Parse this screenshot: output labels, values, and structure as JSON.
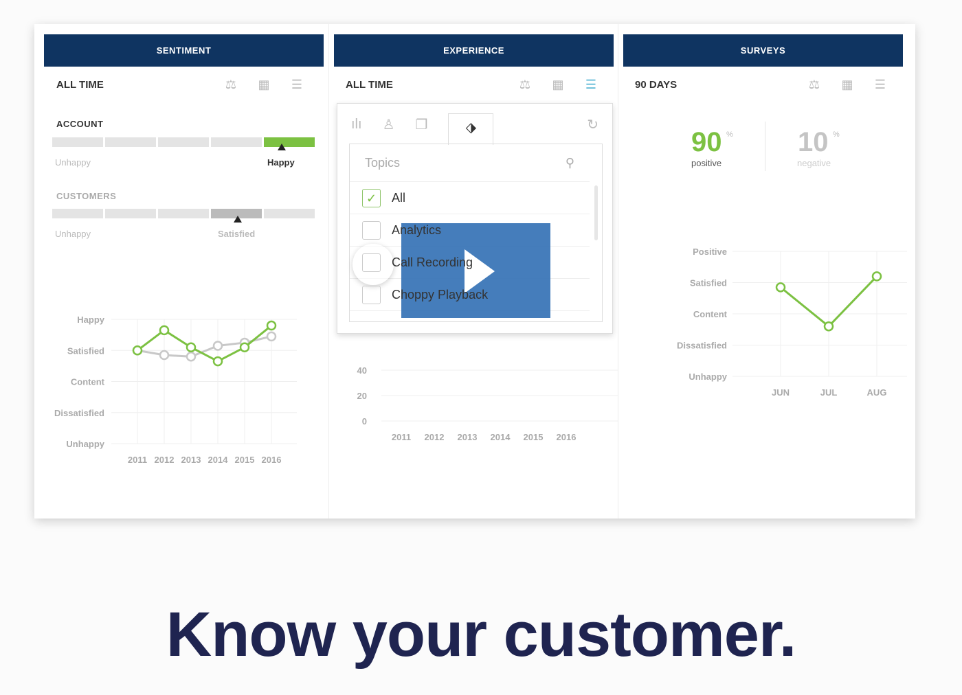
{
  "columns": [
    {
      "title": "SENTIMENT",
      "range": "ALL TIME"
    },
    {
      "title": "EXPERIENCE",
      "range": "ALL TIME"
    },
    {
      "title": "SURVEYS",
      "range": "90 DAYS"
    }
  ],
  "toolbar_icons": [
    "compare-icon",
    "calendar-icon",
    "filter-toggle-icon"
  ],
  "sentiment": {
    "account": {
      "label": "ACCOUNT",
      "left": "Unhappy",
      "value": "Happy",
      "level": 5,
      "of": 5,
      "color": "#7cc142"
    },
    "customers": {
      "label": "CUSTOMERS",
      "left": "Unhappy",
      "value": "Satisfied",
      "level": 4,
      "of": 5
    }
  },
  "popup": {
    "tabs": [
      "chart-icon",
      "user-icon",
      "document-icon",
      "tag-icon"
    ],
    "reset": "refresh-icon",
    "search_placeholder": "Topics",
    "items": [
      {
        "label": "All",
        "checked": true
      },
      {
        "label": "Analytics",
        "checked": false
      },
      {
        "label": "Call Recording",
        "checked": false
      },
      {
        "label": "Choppy Playback",
        "checked": false
      }
    ]
  },
  "surveys": {
    "positive": "90",
    "positive_label": "positive",
    "negative": "10",
    "negative_label": "negative",
    "unit": "%"
  },
  "tagline": "Know your customer.",
  "chart_data": [
    {
      "type": "line",
      "yticks": [
        "Unhappy",
        "Dissatisfied",
        "Content",
        "Satisfied",
        "Happy"
      ],
      "categories": [
        "2011",
        "2012",
        "2013",
        "2014",
        "2015",
        "2016"
      ],
      "series": [
        {
          "color": "#7cc142",
          "values": [
            3.0,
            3.65,
            3.1,
            2.65,
            3.1,
            3.8
          ]
        },
        {
          "color": "#c8c8c8",
          "values": [
            3.0,
            2.85,
            2.8,
            3.15,
            3.25,
            3.45
          ]
        }
      ],
      "ylim": [
        0,
        4
      ],
      "grid": true
    },
    {
      "type": "bar",
      "yticks": [
        "0",
        "20",
        "40"
      ],
      "categories": [
        "2011",
        "2012",
        "2013",
        "2014",
        "2015",
        "2016"
      ],
      "grid": true
    },
    {
      "type": "line",
      "yticks": [
        "Unhappy",
        "Dissatisfied",
        "Content",
        "Satisfied",
        "Positive"
      ],
      "categories": [
        "JUN",
        "JUL",
        "AUG"
      ],
      "series": [
        {
          "color": "#7cc142",
          "values": [
            2.85,
            1.6,
            3.2
          ]
        }
      ],
      "ylim": [
        0,
        4
      ],
      "grid": true
    }
  ]
}
